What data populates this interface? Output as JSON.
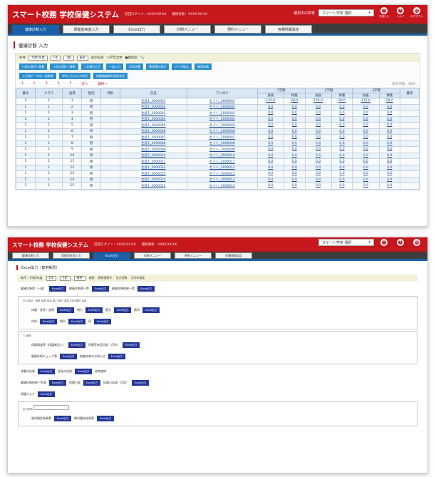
{
  "app": {
    "title": "スマート校務 学校保健システム",
    "meta1": "前回ログイン：XXXX-XX-XX",
    "meta2": "最終更新：XXXX-XX-XX",
    "school_label": "選択中の学校",
    "school_select": "スマート学校 選択",
    "icons": [
      "お知らせ",
      "ヘルプ",
      "ログアウト"
    ]
  },
  "nav": {
    "tabs": [
      "健康診断入力",
      "保健室来室入力",
      "Excel出力",
      "印刷メニュー",
      "便利メニュー",
      "各種情報設定"
    ],
    "active": 0
  },
  "screen1": {
    "page_title": "健康診断 入力",
    "filter": {
      "label": "条件",
      "year": "令和5年度",
      "grade": "1年",
      "cls": "1組",
      "term": "春季",
      "mode_label": "表示形式",
      "radio1": "学年全体",
      "radio2": "組指定"
    },
    "buttons_row1": [
      "←前の項目へ移動",
      "→次の項目へ移動",
      "↓全項目入力",
      "一括入力",
      "学年切替",
      "異常値の表示",
      "データ取込",
      "帳票印刷"
    ],
    "buttons_row2": [
      "入力済データの一括削除",
      "学年ごとの入力状況",
      "保健調査票の回収状況"
    ],
    "pager": [
      "1",
      "2",
      "3",
      "4",
      "5",
      "次へ",
      "最終へ"
    ],
    "pager_right": "表示件数：30件",
    "headers": {
      "no": "番号",
      "cls": "クラス",
      "num": "出席",
      "sex": "性別",
      "sp": "特別",
      "name": "氏名",
      "kana": "フリガナ",
      "grp1": "1学期",
      "grp2": "2学期",
      "grp3": "3学期",
      "sub_a": "身長",
      "sub_b": "体重",
      "remark": "備考"
    },
    "rows": [
      [
        "1",
        "1",
        "1",
        "男",
        "",
        "生徒1_2000001",
        "セイト_2000001",
        "135.0",
        "28.0",
        "135.0",
        "28.0",
        "135.0",
        "28.0"
      ],
      [
        "1",
        "1",
        "2",
        "男",
        "",
        "生徒1_2000002",
        "セイト_2000002",
        "0.0",
        "0.0",
        "0.0",
        "0.0",
        "0.0",
        "0.0"
      ],
      [
        "1",
        "1",
        "3",
        "男",
        "",
        "生徒1_2000003",
        "セイト_2000003",
        "0.0",
        "0.0",
        "0.0",
        "0.0",
        "0.0",
        "0.0"
      ],
      [
        "1",
        "1",
        "4",
        "男",
        "",
        "生徒1_2000004",
        "セイト_2000004",
        "0.0",
        "0.0",
        "0.0",
        "0.0",
        "0.0",
        "0.0"
      ],
      [
        "1",
        "1",
        "5",
        "男",
        "",
        "生徒1_2000005",
        "セイト_2000005",
        "0.0",
        "0.0",
        "0.0",
        "0.0",
        "0.0",
        "0.0"
      ],
      [
        "1",
        "1",
        "6",
        "男",
        "",
        "生徒1_2000006",
        "セイト_2000006",
        "0.0",
        "0.0",
        "0.0",
        "0.0",
        "0.0",
        "0.0"
      ],
      [
        "1",
        "1",
        "7",
        "男",
        "",
        "生徒1_2000007",
        "セイト_2000007",
        "0.0",
        "0.0",
        "0.0",
        "0.0",
        "0.0",
        "0.0"
      ],
      [
        "1",
        "1",
        "8",
        "男",
        "",
        "生徒1_2000008",
        "セイト_2000008",
        "0.0",
        "0.0",
        "0.0",
        "0.0",
        "0.0",
        "0.0"
      ],
      [
        "1",
        "1",
        "9",
        "男",
        "",
        "生徒1_2000009",
        "セイト_2000009",
        "0.0",
        "0.0",
        "0.0",
        "0.0",
        "0.0",
        "0.0"
      ],
      [
        "1",
        "1",
        "10",
        "男",
        "",
        "生徒1_2000010",
        "セイト_2000010",
        "0.0",
        "0.0",
        "0.0",
        "0.0",
        "0.0",
        "0.0"
      ],
      [
        "1",
        "1",
        "11",
        "男",
        "",
        "生徒1_2000011",
        "セイト_2000011",
        "0.0",
        "0.0",
        "0.0",
        "0.0",
        "0.0",
        "0.0"
      ],
      [
        "1",
        "1",
        "12",
        "男",
        "",
        "生徒1_2000012",
        "セイト_2000012",
        "0.0",
        "0.0",
        "0.0",
        "0.0",
        "0.0",
        "0.0"
      ],
      [
        "1",
        "1",
        "13",
        "男",
        "",
        "生徒1_2000013",
        "セイト_2000013",
        "0.0",
        "0.0",
        "0.0",
        "0.0",
        "0.0",
        "0.0"
      ],
      [
        "1",
        "1",
        "14",
        "男",
        "",
        "生徒1_2000014",
        "セイト_2000014",
        "0.0",
        "0.0",
        "0.0",
        "0.0",
        "0.0",
        "0.0"
      ],
      [
        "1",
        "1",
        "15",
        "男",
        "",
        "生徒1_2000015",
        "セイト_2000015",
        "0.0",
        "0.0",
        "0.0",
        "0.0",
        "0.0",
        "0.0"
      ]
    ]
  },
  "screen2": {
    "page_title": "Excel出力（専用帳票）",
    "filter": [
      "条件：令和5年度",
      "1年",
      "1組",
      "春季",
      "検索",
      "異常値表示",
      "出力対象",
      "全学年指定"
    ],
    "row1": [
      "健康診断票（一般）",
      "健康診断票一覧",
      "健康診断結果一覧"
    ],
    "box1_opts": "出力項目：身長 体重 座高 視力 聴力 歯科 内科 眼科 耳鼻",
    "box1_rows": [
      [
        "体重・身長・座高",
        "視力",
        "聴力",
        "歯科"
      ],
      [
        "内科",
        "眼科",
        "尿"
      ]
    ],
    "box2_label": "□ 詳細",
    "box2_rows": [
      [
        "保健調査票（保護者記入）",
        "保健室来室記録（月別）"
      ],
      [
        "健康診断チェック票",
        "検査結果のお知らせ"
      ]
    ],
    "plain_rows": [
      [
        "体重の記録",
        "身長の記録",
        "発育曲線"
      ],
      [
        "健康診断結果一覧表",
        "保健日誌",
        "体重の記録（月別）"
      ],
      [
        "保健だより"
      ]
    ],
    "box3_label": "出力条件",
    "box3_rows": [
      [
        "歯科健診結果票",
        "眼科健診結果票"
      ]
    ],
    "excel": "Excel出力"
  }
}
